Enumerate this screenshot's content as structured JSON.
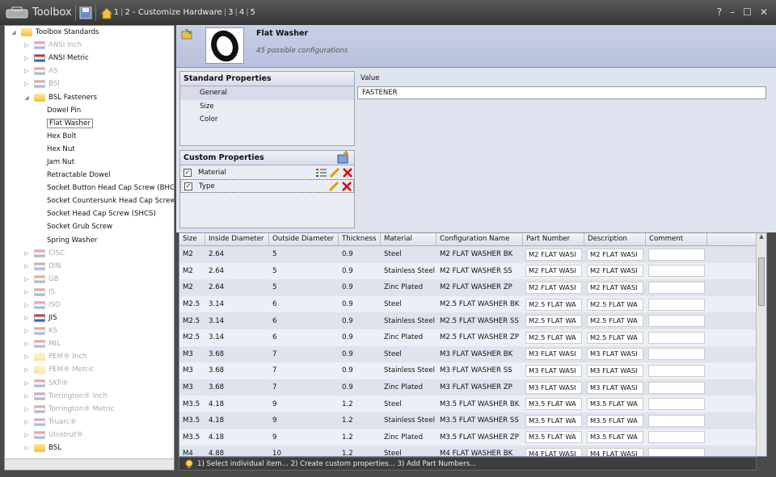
{
  "window": {
    "title": "Toolbox",
    "help": "?",
    "minimize": "–",
    "maximize": "☐",
    "close": "✕"
  },
  "steps": [
    "1",
    "|",
    "2 - Customize Hardware",
    "|",
    "3",
    "|",
    "4",
    "|",
    "5"
  ],
  "tree": [
    {
      "label": "Toolbox Standards",
      "kind": "root",
      "icon": "folder-icon"
    },
    {
      "label": "ANSI Inch",
      "kind": "std",
      "dim": true
    },
    {
      "label": "ANSI Metric",
      "kind": "std",
      "dim": false
    },
    {
      "label": "AS",
      "kind": "std",
      "dim": true
    },
    {
      "label": "BSI",
      "kind": "std",
      "dim": true
    },
    {
      "label": "BSL Fasteners",
      "kind": "open",
      "icon": "folder-icon"
    },
    {
      "label": "Dowel Pin",
      "kind": "leaf"
    },
    {
      "label": "Flat Washer",
      "kind": "leaf",
      "selected": true
    },
    {
      "label": "Hex Bolt",
      "kind": "leaf"
    },
    {
      "label": "Hex Nut",
      "kind": "leaf"
    },
    {
      "label": "Jam Nut",
      "kind": "leaf"
    },
    {
      "label": "Retractable Dowel",
      "kind": "leaf"
    },
    {
      "label": "Socket Button Head Cap Screw (BHCS",
      "kind": "leaf"
    },
    {
      "label": "Socket Countersunk Head Cap Screw (",
      "kind": "leaf"
    },
    {
      "label": "Socket Head Cap Screw (SHCS)",
      "kind": "leaf"
    },
    {
      "label": "Socket Grub Screw",
      "kind": "leaf"
    },
    {
      "label": "Spring Washer",
      "kind": "leaf"
    },
    {
      "label": "CISC",
      "kind": "std",
      "dim": true
    },
    {
      "label": "DIN",
      "kind": "std",
      "dim": true
    },
    {
      "label": "GB",
      "kind": "std",
      "dim": true
    },
    {
      "label": "IS",
      "kind": "std",
      "dim": true
    },
    {
      "label": "ISO",
      "kind": "std",
      "dim": true
    },
    {
      "label": "JIS",
      "kind": "std",
      "dim": false
    },
    {
      "label": "KS",
      "kind": "std",
      "dim": true
    },
    {
      "label": "MIL",
      "kind": "std",
      "dim": true
    },
    {
      "label": "PEM® Inch",
      "kind": "fold",
      "dim": true
    },
    {
      "label": "PEM® Metric",
      "kind": "fold",
      "dim": true
    },
    {
      "label": "SKF®",
      "kind": "std",
      "dim": true
    },
    {
      "label": "Torrington® Inch",
      "kind": "std",
      "dim": true
    },
    {
      "label": "Torrington® Metric",
      "kind": "std",
      "dim": true
    },
    {
      "label": "Truarc®",
      "kind": "std",
      "dim": true
    },
    {
      "label": "Unistrut®",
      "kind": "std",
      "dim": true
    },
    {
      "label": "BSL",
      "kind": "fold",
      "dim": false
    }
  ],
  "part": {
    "name": "Flat Washer",
    "configs": "45 possible configurations"
  },
  "standard": {
    "title": "Standard Properties",
    "items": [
      "General",
      "Size",
      "Color"
    ]
  },
  "custom": {
    "title": "Custom Properties",
    "items": [
      "Material",
      "Type"
    ]
  },
  "value": {
    "label": "Value",
    "text": "FASTENER"
  },
  "grid": {
    "headers": [
      "Size",
      "Inside Diameter",
      "Outside Diameter",
      "Thickness",
      "Material",
      "Configuration Name",
      "Part Number",
      "Description",
      "Comment"
    ],
    "rows": [
      [
        "M2",
        "2.64",
        "5",
        "0.9",
        "Steel",
        "M2 FLAT WASHER BK",
        "M2 FLAT WASI",
        "M2 FLAT WASI",
        ""
      ],
      [
        "M2",
        "2.64",
        "5",
        "0.9",
        "Stainless Steel",
        "M2 FLAT WASHER SS",
        "M2 FLAT WASI",
        "M2 FLAT WASI",
        ""
      ],
      [
        "M2",
        "2.64",
        "5",
        "0.9",
        "Zinc Plated",
        "M2 FLAT WASHER ZP",
        "M2 FLAT WASI",
        "M2 FLAT WASI",
        ""
      ],
      [
        "M2.5",
        "3.14",
        "6",
        "0.9",
        "Steel",
        "M2.5 FLAT WASHER BK",
        "M2.5 FLAT WA",
        "M2.5 FLAT WA",
        ""
      ],
      [
        "M2.5",
        "3.14",
        "6",
        "0.9",
        "Stainless Steel",
        "M2.5 FLAT WASHER SS",
        "M2.5 FLAT WA",
        "M2.5 FLAT WA",
        ""
      ],
      [
        "M2.5",
        "3.14",
        "6",
        "0.9",
        "Zinc Plated",
        "M2.5 FLAT WASHER ZP",
        "M2.5 FLAT WA",
        "M2.5 FLAT WA",
        ""
      ],
      [
        "M3",
        "3.68",
        "7",
        "0.9",
        "Steel",
        "M3 FLAT WASHER BK",
        "M3 FLAT WASI",
        "M3 FLAT WASI",
        ""
      ],
      [
        "M3",
        "3.68",
        "7",
        "0.9",
        "Stainless Steel",
        "M3 FLAT WASHER SS",
        "M3 FLAT WASI",
        "M3 FLAT WASI",
        ""
      ],
      [
        "M3",
        "3.68",
        "7",
        "0.9",
        "Zinc Plated",
        "M3 FLAT WASHER ZP",
        "M3 FLAT WASI",
        "M3 FLAT WASI",
        ""
      ],
      [
        "M3.5",
        "4.18",
        "9",
        "1.2",
        "Steel",
        "M3.5 FLAT WASHER BK",
        "M3.5 FLAT WA",
        "M3.5 FLAT WA",
        ""
      ],
      [
        "M3.5",
        "4.18",
        "9",
        "1.2",
        "Stainless Steel",
        "M3.5 FLAT WASHER SS",
        "M3.5 FLAT WA",
        "M3.5 FLAT WA",
        ""
      ],
      [
        "M3.5",
        "4.18",
        "9",
        "1.2",
        "Zinc Plated",
        "M3.5 FLAT WASHER ZP",
        "M3.5 FLAT WA",
        "M3.5 FLAT WA",
        ""
      ],
      [
        "M4",
        "4.88",
        "10",
        "1.2",
        "Steel",
        "M4 FLAT WASHER BK",
        "M4 FLAT WASI",
        "M4 FLAT WASI",
        ""
      ]
    ]
  },
  "status": "1) Select individual item... 2) Create custom properties... 3) Add Part Numbers..."
}
